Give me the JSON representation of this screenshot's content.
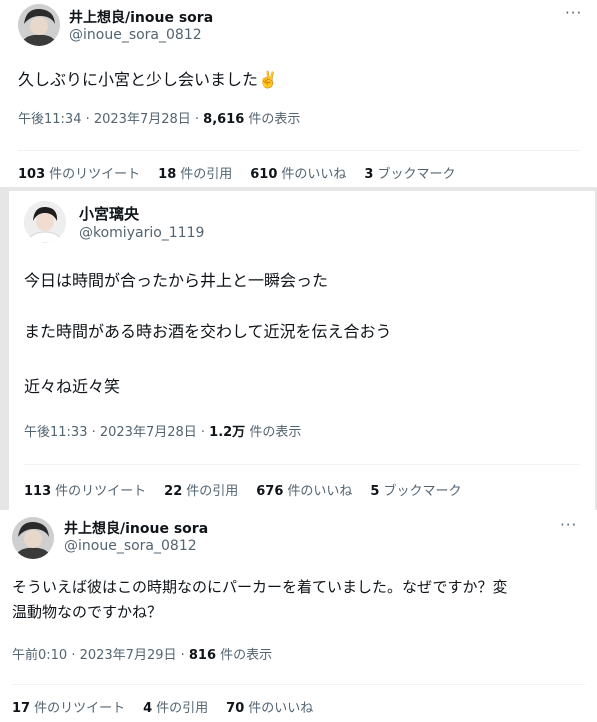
{
  "tweets": [
    {
      "name": "井上想良/inoue sora",
      "handle": "@inoue_sora_0812",
      "text_lines": [
        "久しぶりに小宮と少し会いました✌️"
      ],
      "time": "午後11:34 · 2023年7月28日 · ",
      "views_count": "8,616",
      "views_label": " 件の表示",
      "stats": [
        {
          "count": "103",
          "label": "件のリツイート"
        },
        {
          "count": "18",
          "label": "件の引用"
        },
        {
          "count": "610",
          "label": "件のいいね"
        },
        {
          "count": "3",
          "label": "ブックマーク"
        }
      ],
      "more": "···"
    },
    {
      "name": "小宮璃央",
      "handle": "@komiyario_1119",
      "text_lines": [
        "今日は時間が合ったから井上と一瞬会った",
        "また時間がある時お酒を交わして近況を伝え合おう",
        "近々ね近々笑"
      ],
      "time": "午後11:33 · 2023年7月28日 · ",
      "views_count": "1.2万",
      "views_label": " 件の表示",
      "stats": [
        {
          "count": "113",
          "label": "件のリツイート"
        },
        {
          "count": "22",
          "label": "件の引用"
        },
        {
          "count": "676",
          "label": "件のいいね"
        },
        {
          "count": "5",
          "label": "ブックマーク"
        }
      ]
    },
    {
      "name": "井上想良/inoue sora",
      "handle": "@inoue_sora_0812",
      "text_lines": [
        "そういえば彼はこの時期なのにパーカーを着ていました。なぜですか？変",
        "温動物なのですかね？"
      ],
      "time": "午前0:10 · 2023年7月29日 · ",
      "views_count": "816",
      "views_label": " 件の表示",
      "stats": [
        {
          "count": "17",
          "label": "件のリツイート"
        },
        {
          "count": "4",
          "label": "件の引用"
        },
        {
          "count": "70",
          "label": "件のいいね"
        }
      ],
      "more": "···"
    }
  ],
  "icons": [
    "more-icon",
    "avatar"
  ],
  "colors": {
    "text": "#0f1419",
    "secondary": "#536471",
    "background": "#ffffff",
    "gap": "#e6e6e6"
  }
}
